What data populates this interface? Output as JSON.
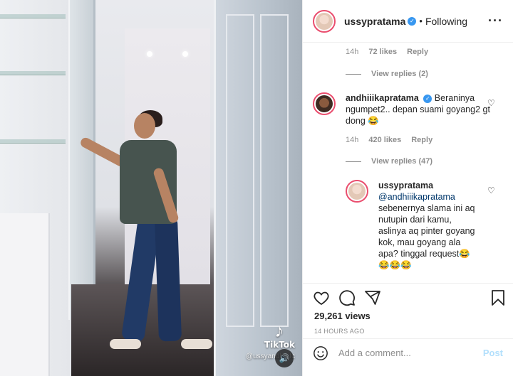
{
  "video": {
    "watermark_brand": "TikTok",
    "watermark_user": "@ussyandh...fc",
    "logo_icon": "tiktok-note-icon",
    "sound_icon": "speaker-icon"
  },
  "header": {
    "username": "ussypratama",
    "separator": "•",
    "follow_status": "Following",
    "more_icon": "ellipsis-icon"
  },
  "comments": {
    "first_meta": {
      "time": "14h",
      "likes": "72 likes",
      "reply": "Reply"
    },
    "first_view_replies": "View replies (2)",
    "second": {
      "username": "andhiiikapratama",
      "text": "Beraninya ngumpet2.. depan suami goyang2 gt dong 😂",
      "meta": {
        "time": "14h",
        "likes": "420 likes",
        "reply": "Reply"
      },
      "view_replies": "View replies (47)"
    },
    "reply": {
      "username": "ussypratama",
      "mention": "@andhiiikapratama",
      "text": "sebenernya slama ini aq nutupin dari kamu, aslinya aq pinter goyang kok, mau goyang ala apa? tinggal request😂 😂😂😂"
    }
  },
  "actions": {
    "views": "29,261 views",
    "timestamp": "14 HOURS AGO",
    "icons": [
      "heart-icon",
      "comment-icon",
      "share-icon",
      "bookmark-icon"
    ]
  },
  "add_comment": {
    "placeholder": "Add a comment...",
    "post_label": "Post"
  },
  "colors": {
    "verified": "#3897f0",
    "post_disabled": "#b2dffc",
    "story_ring": "#ea4e6e",
    "muted": "#8e8e8e"
  }
}
